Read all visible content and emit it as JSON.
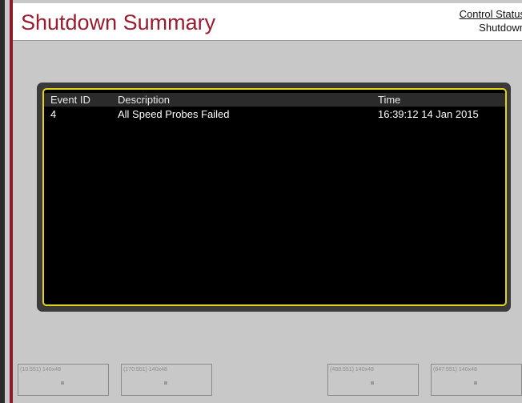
{
  "header": {
    "title": "Shutdown Summary",
    "status_link": "Control Status",
    "status_value": "Shutdown"
  },
  "table": {
    "columns": [
      "Event ID",
      "Description",
      "Time"
    ],
    "rows": [
      {
        "event_id": "4",
        "description": "All Speed Probes Failed",
        "time": "16:39:12 14 Jan 2015"
      }
    ]
  },
  "footer_slots": [
    {
      "label": "(10:551) 140x48"
    },
    {
      "label": "(170:551) 140x48"
    },
    {
      "label": "(488:551) 140x48"
    },
    {
      "label": "(647:551) 140x48"
    }
  ],
  "colors": {
    "title": "#9a1b2e",
    "panel_border": "#e3d316",
    "panel_bg": "#000000",
    "background": "#c8c8c8"
  }
}
